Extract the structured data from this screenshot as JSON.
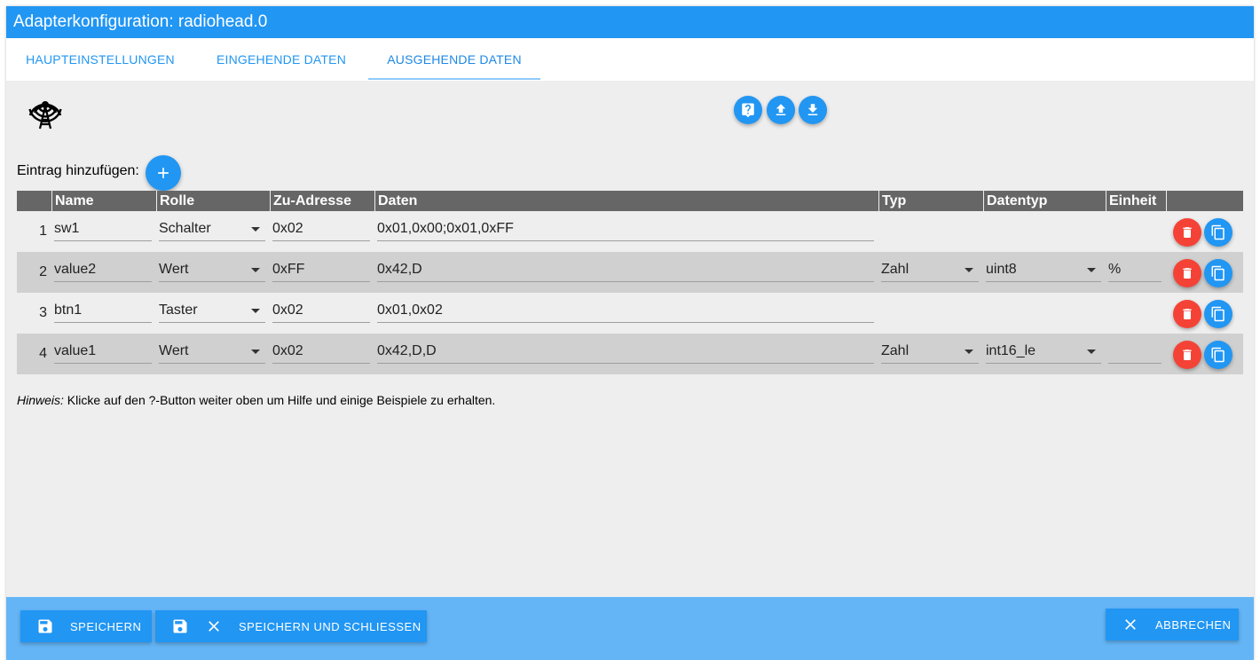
{
  "window": {
    "title": "Adapterkonfiguration: radiohead.0"
  },
  "tabs": [
    {
      "label": "HAUPTEINSTELLUNGEN"
    },
    {
      "label": "EINGEHENDE DATEN"
    },
    {
      "label": "AUSGEHENDE DATEN",
      "active": true
    }
  ],
  "toolbar": {
    "icons": [
      "help-icon",
      "upload-icon",
      "download-icon"
    ]
  },
  "add_entry": {
    "label": "Eintrag hinzufügen:"
  },
  "table": {
    "headers": [
      "Name",
      "Rolle",
      "Zu-Adresse",
      "Daten",
      "Typ",
      "Datentyp",
      "Einheit"
    ],
    "rows": [
      {
        "index": "1",
        "name": "sw1",
        "rolle": "Schalter",
        "adresse": "0x02",
        "daten": "0x01,0x00;0x01,0xFF",
        "typ": "",
        "datentyp": "",
        "einheit": ""
      },
      {
        "index": "2",
        "name": "value2",
        "rolle": "Wert",
        "adresse": "0xFF",
        "daten": "0x42,D",
        "typ": "Zahl",
        "datentyp": "uint8",
        "einheit": "%"
      },
      {
        "index": "3",
        "name": "btn1",
        "rolle": "Taster",
        "adresse": "0x02",
        "daten": "0x01,0x02",
        "typ": "",
        "datentyp": "",
        "einheit": ""
      },
      {
        "index": "4",
        "name": "value1",
        "rolle": "Wert",
        "adresse": "0x02",
        "daten": "0x42,D,D",
        "typ": "Zahl",
        "datentyp": "int16_le",
        "einheit": ""
      }
    ]
  },
  "hint": {
    "prefix": "Hinweis:",
    "text": " Klicke auf den ?-Button weiter oben um Hilfe und einige Beispiele zu erhalten."
  },
  "footer": {
    "save": "SPEICHERN",
    "save_close": "SPEICHERN UND SCHLIESSEN",
    "cancel": "ABBRECHEN"
  },
  "colors": {
    "primary": "#2196f3",
    "footer": "#64b5f6",
    "delete": "#f44336",
    "header": "#666666"
  }
}
